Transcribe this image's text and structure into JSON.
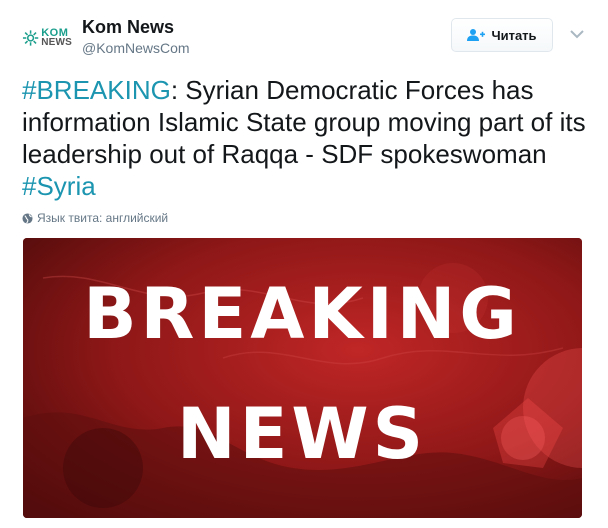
{
  "account": {
    "logo_kom": "KOM",
    "logo_news": "NEWS",
    "display_name": "Kom News",
    "screen_name": "@KomNewsCom"
  },
  "follow": {
    "label": "Читать",
    "icon": "add-user-icon"
  },
  "tweet": {
    "hashtag1": "#BREAKING",
    "body": ": Syrian Democratic Forces has information Islamic State group moving part of its leadership out of Raqqa - SDF spokeswoman ",
    "hashtag2": "#Syria"
  },
  "language": {
    "label": "Язык твита: английский",
    "icon": "globe-icon"
  },
  "media": {
    "line1": "BREAKING",
    "line2": "NEWS"
  },
  "colors": {
    "hashtag": "#1b95b0",
    "media_bg": "#7a1212",
    "logo_accent": "#1b9e8c"
  }
}
